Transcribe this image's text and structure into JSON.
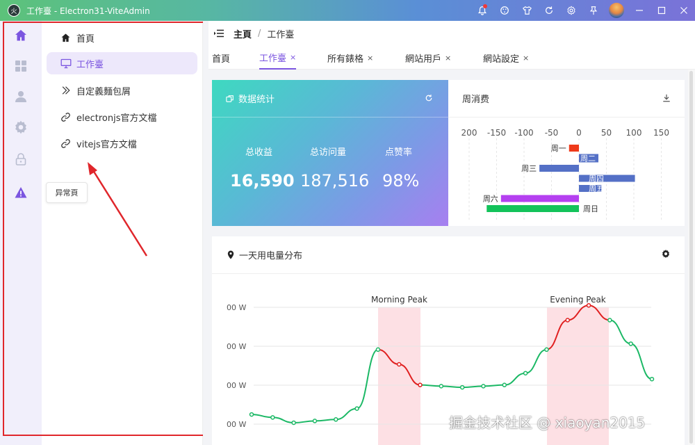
{
  "window": {
    "title": "工作臺 - Electron31-ViteAdmin",
    "logo_text": "火"
  },
  "sidebar_icons": [
    {
      "name": "home-icon",
      "active": true
    },
    {
      "name": "grid-icon"
    },
    {
      "name": "user-icon"
    },
    {
      "name": "gear-icon"
    },
    {
      "name": "lock-icon"
    },
    {
      "name": "warning-icon"
    }
  ],
  "tooltip": "异常頁",
  "submenu": [
    {
      "label": "首頁",
      "icon": "home-icon"
    },
    {
      "label": "工作臺",
      "icon": "monitor-icon",
      "active": true
    },
    {
      "label": "自定義麵包屑",
      "icon": "chevrons-icon"
    },
    {
      "label": "electronjs官方文檔",
      "icon": "link-icon"
    },
    {
      "label": "vitejs官方文檔",
      "icon": "link-icon"
    }
  ],
  "breadcrumb": {
    "root": "主頁",
    "sep": "/",
    "current": "工作臺"
  },
  "tabs": [
    {
      "label": "首頁",
      "closable": false
    },
    {
      "label": "工作臺",
      "closable": true,
      "active": true
    },
    {
      "label": "所有錶格",
      "closable": true
    },
    {
      "label": "網站用戶",
      "closable": true
    },
    {
      "label": "網站設定",
      "closable": true
    }
  ],
  "close_glyph": "×",
  "stats_card": {
    "title": "数据统计",
    "items": [
      {
        "label": "总收益",
        "value": "16,590"
      },
      {
        "label": "总访问量",
        "value": "187,516"
      },
      {
        "label": "点赞率",
        "value": "98%"
      }
    ]
  },
  "weekly_card": {
    "title": "周消费"
  },
  "power_card": {
    "title": "一天用电量分布"
  },
  "colors": {
    "accent": "#7b55e0",
    "red_line": "#e01f1f",
    "green_line": "#1bb865",
    "peak_band": "#fde0e4"
  },
  "chart_data": [
    {
      "type": "bar",
      "orientation": "horizontal",
      "categories": [
        "周一",
        "周二",
        "周三",
        "周四",
        "周五",
        "周六",
        "周日"
      ],
      "values": [
        -18,
        0,
        -72,
        102,
        41,
        -142,
        -168
      ],
      "colors": [
        "#ee3a1a",
        "#5470c6",
        "#5470c6",
        "#5470c6",
        "#5470c6",
        "#b540f0",
        "#13c35a"
      ],
      "xticks": [
        "200",
        "-150",
        "-100",
        "-50",
        "0",
        "50",
        "100",
        "150"
      ],
      "xtick_values": [
        -200,
        -150,
        -100,
        -50,
        0,
        50,
        100,
        150
      ],
      "grid": true
    },
    {
      "type": "line",
      "x": [
        0,
        1,
        2,
        3,
        4,
        5,
        6,
        7,
        8,
        9,
        10,
        11,
        12,
        13,
        14,
        15,
        16,
        17,
        18,
        19,
        20,
        21,
        22,
        23,
        24,
        25,
        26,
        27,
        28
      ],
      "values": [
        280,
        270,
        252,
        258,
        263,
        272,
        300,
        500,
        450,
        380,
        380,
        378,
        376,
        378,
        382,
        390,
        450,
        505,
        590,
        650,
        680,
        670,
        600,
        530,
        420,
        390,
        370,
        360,
        350
      ],
      "line_values_shown": [
        280,
        270,
        252,
        258,
        263,
        300,
        500,
        450,
        380,
        376,
        372,
        376,
        380,
        420,
        500,
        600,
        650,
        600,
        520,
        400
      ],
      "y_tick_labels": [
        "00 W",
        "00 W",
        "00 W",
        "00 W"
      ],
      "bands": [
        {
          "label": "Morning Peak"
        },
        {
          "label": "Evening Peak"
        }
      ],
      "grid": true
    }
  ],
  "watermark": "掘金技术社区 @ xiaoyan2015"
}
